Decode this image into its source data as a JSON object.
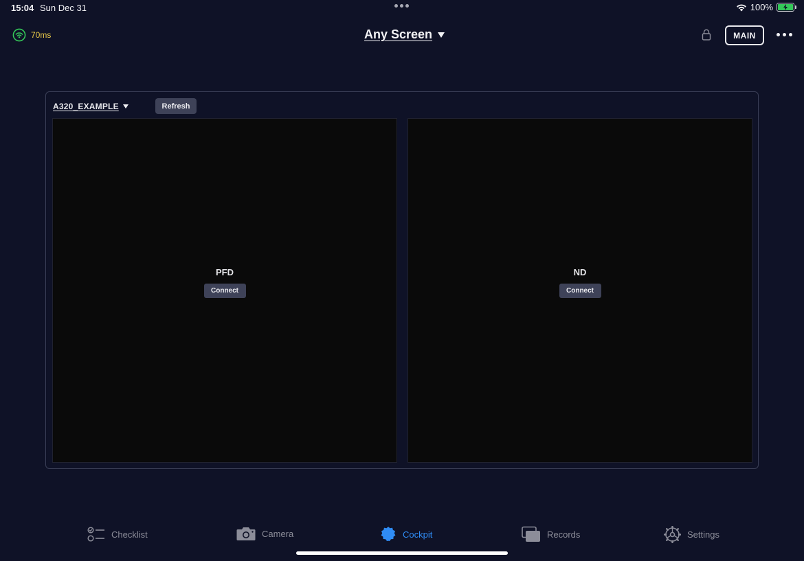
{
  "status_bar": {
    "time": "15:04",
    "date": "Sun Dec 31",
    "battery_percent": "100%"
  },
  "top_bar": {
    "latency": "70ms",
    "screen_title": "Any Screen",
    "main_label": "MAIN"
  },
  "panel": {
    "profile": "A320_EXAMPLE",
    "refresh_label": "Refresh",
    "displays": [
      {
        "label": "PFD",
        "connect_label": "Connect"
      },
      {
        "label": "ND",
        "connect_label": "Connect"
      }
    ]
  },
  "tabs": [
    {
      "label": "Checklist",
      "icon": "checklist-icon",
      "active": false
    },
    {
      "label": "Camera",
      "icon": "camera-icon",
      "active": false
    },
    {
      "label": "Cockpit",
      "icon": "cockpit-icon",
      "active": true
    },
    {
      "label": "Records",
      "icon": "records-icon",
      "active": false
    },
    {
      "label": "Settings",
      "icon": "settings-icon",
      "active": false
    }
  ],
  "colors": {
    "background": "#0f1227",
    "accent": "#2f8cf5",
    "latency_text": "#e7c848",
    "wifi_ok": "#34c759"
  }
}
